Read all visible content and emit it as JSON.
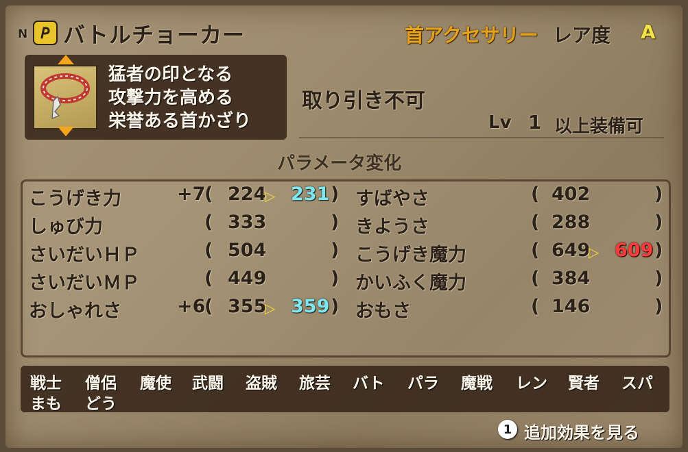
{
  "header": {
    "quality_mark": "N",
    "item_name": "バトルチョーカー",
    "category": "首アクセサリー",
    "rarity_label": "レア度",
    "rarity_value": "A"
  },
  "description": {
    "lines": [
      "猛者の印となる",
      "攻撃力を高める",
      "栄誉ある首かざり"
    ]
  },
  "trade_status": "取り引き不可",
  "level_requirement": {
    "label": "Lv",
    "value": "1",
    "suffix": "以上装備可"
  },
  "params": {
    "title": "パラメータ変化",
    "left": [
      {
        "name": "こうげき力",
        "bonus": "+7",
        "current": "224",
        "new": "231",
        "change": "up"
      },
      {
        "name": "しゅび力",
        "bonus": "",
        "current": "333",
        "new": "",
        "change": ""
      },
      {
        "name": "さいだいＨＰ",
        "bonus": "",
        "current": "504",
        "new": "",
        "change": ""
      },
      {
        "name": "さいだいＭＰ",
        "bonus": "",
        "current": "449",
        "new": "",
        "change": ""
      },
      {
        "name": "おしゃれさ",
        "bonus": "+6",
        "current": "355",
        "new": "359",
        "change": "up"
      }
    ],
    "right": [
      {
        "name": "すばやさ",
        "current": "402",
        "new": "",
        "change": ""
      },
      {
        "name": "きようさ",
        "current": "288",
        "new": "",
        "change": ""
      },
      {
        "name": "こうげき魔力",
        "current": "649",
        "new": "609",
        "change": "down"
      },
      {
        "name": "かいふく魔力",
        "current": "384",
        "new": "",
        "change": ""
      },
      {
        "name": "おもさ",
        "current": "146",
        "new": "",
        "change": ""
      }
    ]
  },
  "jobs": {
    "row1": [
      "戦士",
      "僧侶",
      "魔使",
      "武闘",
      "盗賊",
      "旅芸",
      "バト",
      "パラ",
      "魔戦",
      "レン",
      "賢者",
      "スパ"
    ],
    "row2": [
      "まも",
      "どう"
    ]
  },
  "prompt": {
    "button": "1",
    "label": "追加効果を見る"
  },
  "colors": {
    "increase": "#7fe6ef",
    "decrease": "#ff3a3a",
    "category": "#e6a21c",
    "rarity": "#f3e14a"
  }
}
